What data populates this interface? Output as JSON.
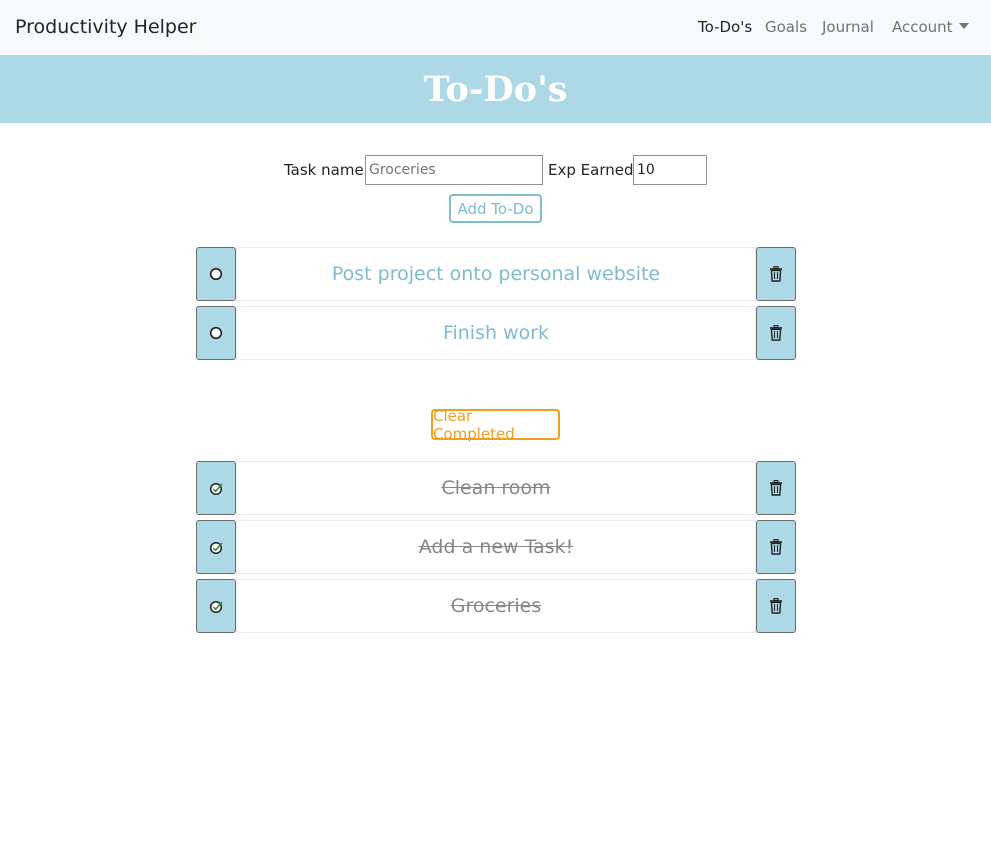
{
  "navbar": {
    "brand": "Productivity Helper",
    "links": [
      "To-Do's",
      "Goals",
      "Journal",
      "Account"
    ]
  },
  "page": {
    "title": "To-Do's"
  },
  "form": {
    "task_label": "Task name:",
    "task_placeholder": "Groceries",
    "exp_label": "Exp Earned:",
    "exp_value": "10",
    "add_button": "Add To-Do"
  },
  "todos": [
    {
      "title": "Post project onto personal website",
      "completed": false
    },
    {
      "title": "Finish work",
      "completed": false
    }
  ],
  "clear_button": "Clear Completed",
  "completed": [
    {
      "title": "Clean room",
      "completed": true
    },
    {
      "title": "Add a new Task!",
      "completed": true
    },
    {
      "title": "Groceries",
      "completed": true
    }
  ],
  "colors": {
    "accent": "#add8e6",
    "link": "#7fbbcf",
    "warning": "#f0a020"
  },
  "icons": {
    "unchecked": "circle-icon",
    "checked": "check-circle-icon",
    "delete": "trash-icon"
  }
}
